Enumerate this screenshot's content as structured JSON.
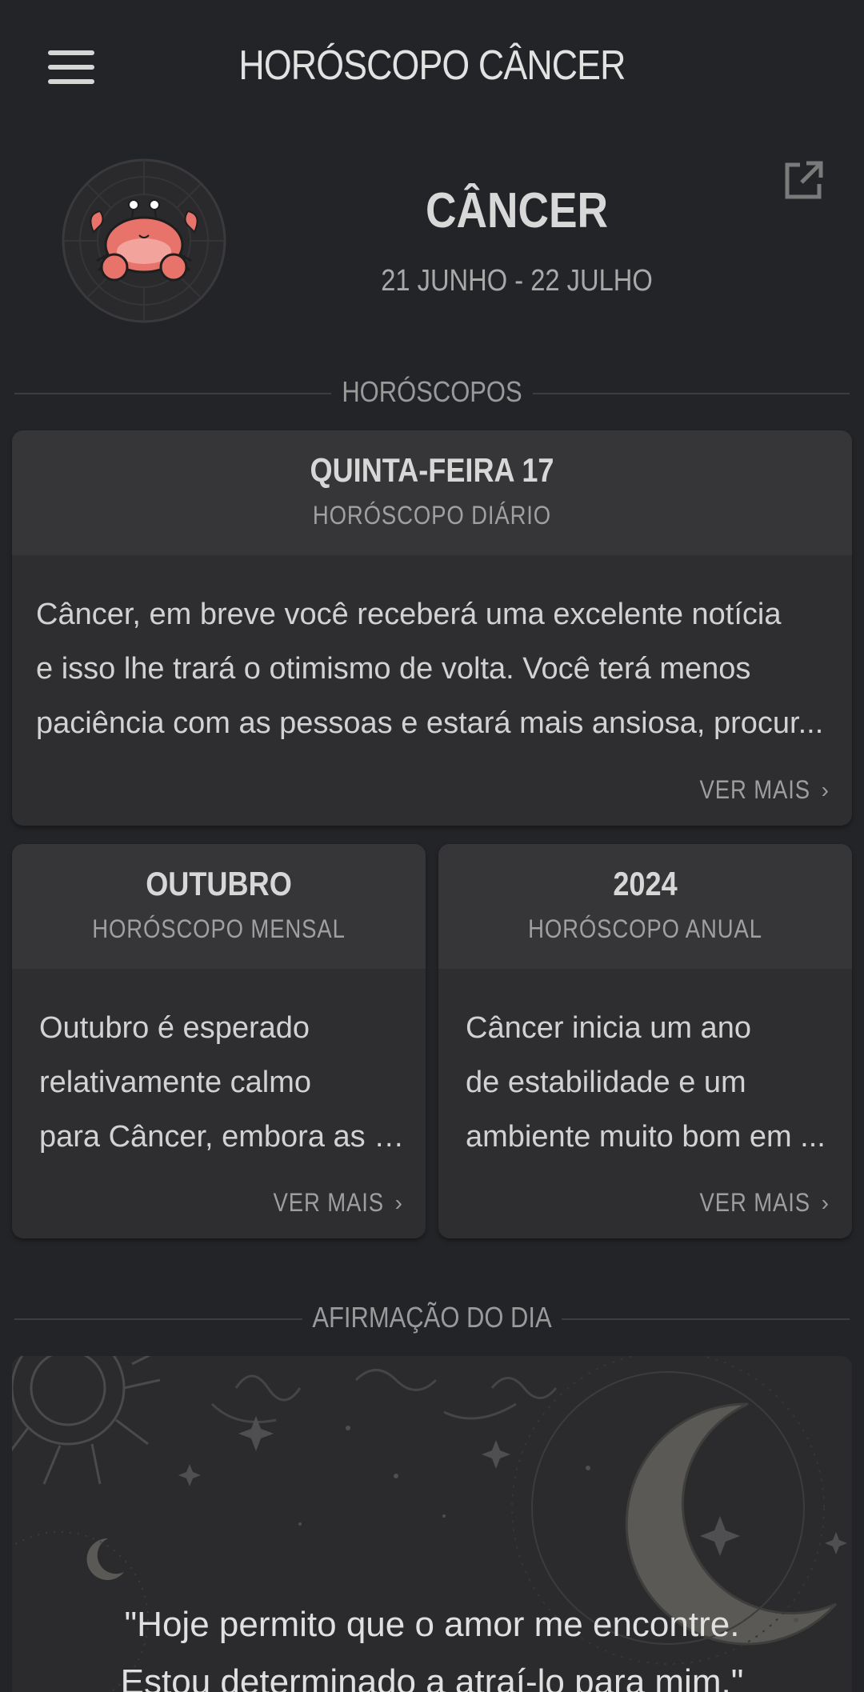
{
  "header": {
    "title": "HORÓSCOPO CÂNCER"
  },
  "sign": {
    "name": "CÂNCER",
    "dates": "21 JUNHO - 22 JULHO",
    "icon": "crab-icon"
  },
  "sections": {
    "horoscopes": "HORÓSCOPOS",
    "affirmation": "AFIRMAÇÃO DO DIA"
  },
  "daily": {
    "title": "QUINTA-FEIRA 17",
    "subtitle": "HORÓSCOPO DIÁRIO",
    "lines": [
      "Câncer, em breve você receberá uma excelente notícia",
      "e isso lhe trará o otimismo de volta. Você terá menos",
      "paciência com as pessoas e estará mais ansiosa, procur..."
    ],
    "more": "VER MAIS"
  },
  "monthly": {
    "title": "OUTUBRO",
    "subtitle": "HORÓSCOPO MENSAL",
    "lines": [
      "Outubro é esperado",
      "relativamente calmo",
      "para Câncer, embora as e..."
    ],
    "more": "VER MAIS"
  },
  "yearly": {
    "title": "2024",
    "subtitle": "HORÓSCOPO ANUAL",
    "lines": [
      "Câncer inicia um ano",
      "de estabilidade e um",
      "ambiente muito bom em ..."
    ],
    "more": "VER MAIS"
  },
  "affirmation": {
    "lines": [
      "\"Hoje permito que o amor me encontre.",
      "Estou determinado a atraí-lo para mim.\""
    ]
  },
  "colors": {
    "background": "#232427",
    "card": "#2e2e30",
    "card_header": "#363638",
    "crab": "#e8736b"
  }
}
